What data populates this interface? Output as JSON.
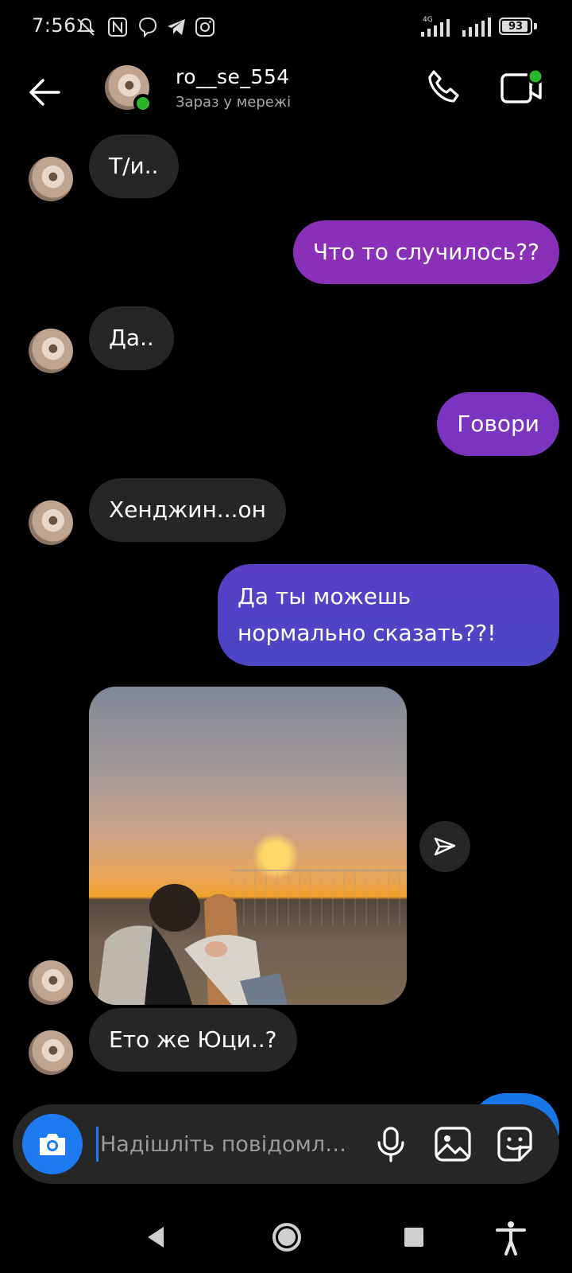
{
  "status_bar": {
    "time": "7:56",
    "battery": "93",
    "battery_level": 0.93,
    "network": "4G",
    "icons": [
      "mute-icon",
      "nfc-icon",
      "viber-icon",
      "telegram-icon",
      "instagram-icon",
      "signal-icon",
      "battery-icon"
    ]
  },
  "header": {
    "contact_name": "ro__se_554",
    "contact_status": "Зараз у мережі",
    "online_color": "#2bb52b"
  },
  "messages": [
    {
      "side": "in",
      "text": "Т/и.."
    },
    {
      "side": "out",
      "text": "Что то случилось??"
    },
    {
      "side": "in",
      "text": "Да.."
    },
    {
      "side": "out",
      "text": "Говори"
    },
    {
      "side": "in",
      "text": "Хенджин...он"
    },
    {
      "side": "out",
      "text": "Да ты можешь нормально сказать??!"
    },
    {
      "side": "in",
      "type": "photo"
    },
    {
      "side": "in",
      "text": "Ето же Юци..?"
    }
  ],
  "composer": {
    "placeholder": "Надішліть повідомл…"
  },
  "colors": {
    "background": "#000000",
    "incoming_bubble": "#262626",
    "outgoing_purple": "#8a2fb8",
    "outgoing_indigo": "#4a46c4",
    "accent_blue": "#1d7af0"
  }
}
